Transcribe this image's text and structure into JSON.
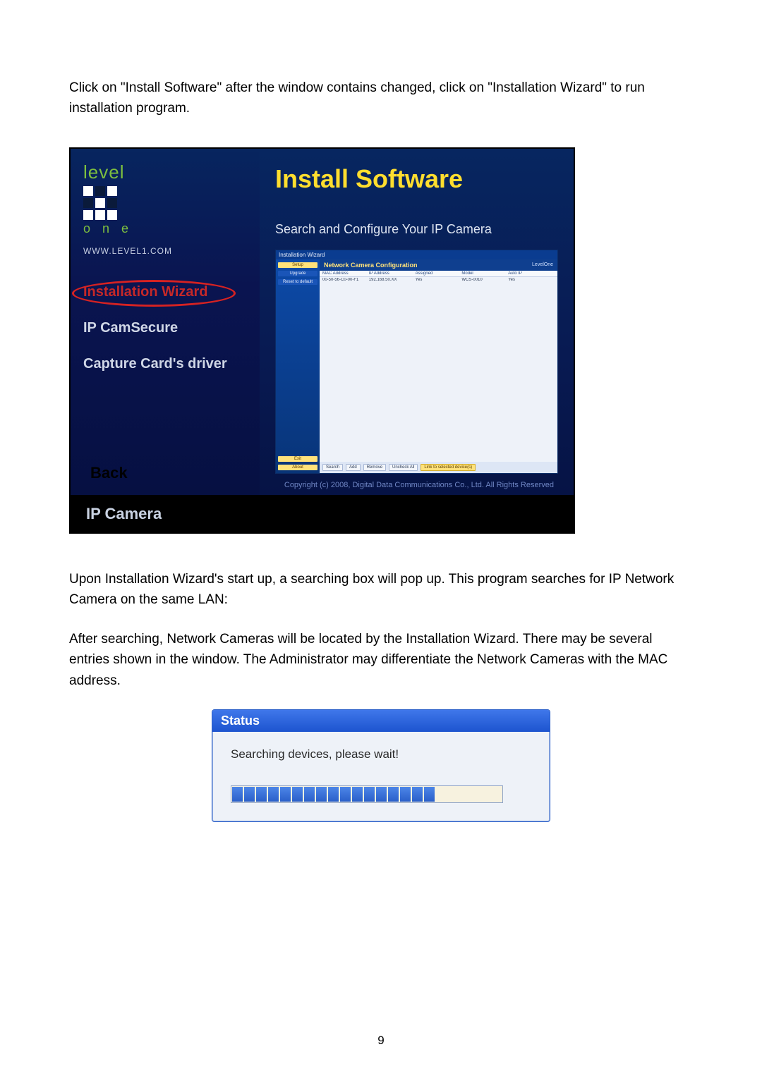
{
  "paragraphs": {
    "p1": "Click on \"Install Software\" after the window contains changed, click on \"Installation Wizard\" to run installation program.",
    "p2": "Upon Installation Wizard's start up, a searching box will pop up. This program searches for IP Network Camera on the same LAN:",
    "p3": "After searching, Network Cameras will be located by the Installation Wizard. There may be several entries shown in the window. The Administrator may differentiate the Network Cameras with the MAC address."
  },
  "installer": {
    "logo_word": "level",
    "logo_one": "o n e",
    "url": "WWW.LEVEL1.COM",
    "nav": {
      "wizard": "Installation Wizard",
      "camsecure": "IP CamSecure",
      "capture": "Capture Card's driver",
      "back": "Back"
    },
    "title": "Install Software",
    "subtitle": "Search and Configure Your IP Camera",
    "mini": {
      "titlebar": "Installation Wizard",
      "header": "Network Camera Configuration",
      "brand": "LevelOne",
      "left_buttons": {
        "setup": "Setup",
        "upgrade": "Upgrade",
        "reset": "Reset to default",
        "exit": "Exit",
        "about": "About"
      },
      "cols": {
        "mac": "MAC Address",
        "ip": "IP Address",
        "assigned": "Assigned",
        "model": "Model",
        "auto": "Auto IP"
      },
      "row": {
        "mac": "00-50-56-C0-00-F1",
        "ip": "192.168.50.XX",
        "assigned": "Yes",
        "model": "WCS-0010",
        "auto": "Yes"
      },
      "bottom": {
        "search": "Search",
        "add": "Add",
        "remove": "Remove",
        "uncheck": "Uncheck All",
        "link": "Link to selected device(s)"
      }
    },
    "copyright": "Copyright (c) 2008, Digital Data Communications Co., Ltd.  All Rights Reserved",
    "footer": "IP Camera"
  },
  "status": {
    "title": "Status",
    "message": "Searching devices, please wait!",
    "segments": 17
  },
  "page_number": "9"
}
